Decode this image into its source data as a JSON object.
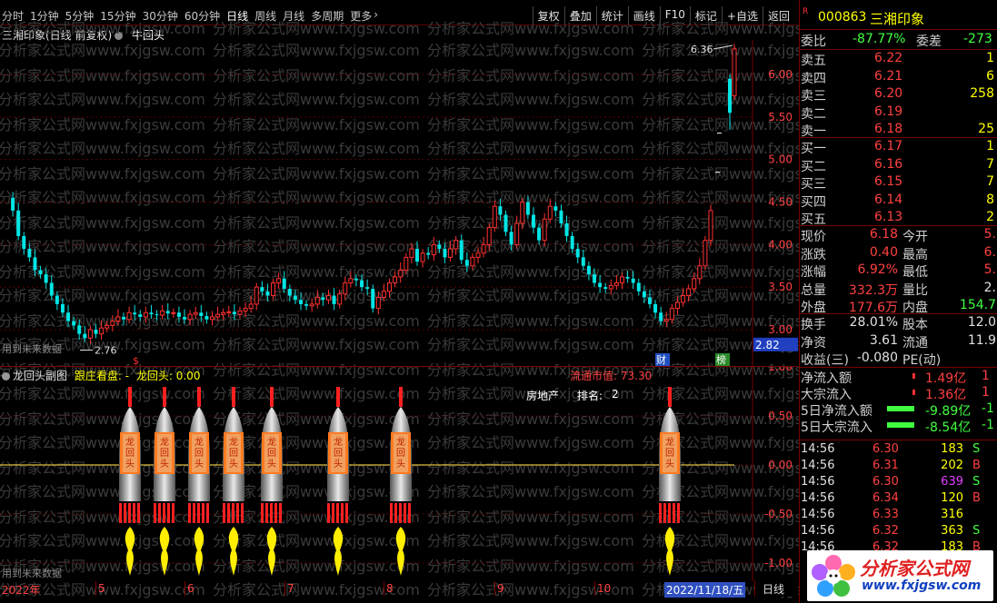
{
  "toolbar": {
    "timeframes": [
      "分时",
      "1分钟",
      "5分钟",
      "15分钟",
      "30分钟",
      "60分钟",
      "日线",
      "周线",
      "月线",
      "多周期",
      "更多"
    ],
    "active": "日线",
    "actions": [
      "复权",
      "叠加",
      "统计",
      "画线",
      "F10",
      "标记",
      "+自选",
      "返回"
    ]
  },
  "main_chart": {
    "title": "三湘印象(日线 前复权)",
    "indicator": "牛回头",
    "y_ticks": [
      "6.00",
      "5.50",
      "5.00",
      "4.50",
      "4.00",
      "3.50",
      "3.00"
    ],
    "high_label": "6.36",
    "low_label": "2.76",
    "current_price_tag": "2.82",
    "note": "用到未来数据",
    "markers": {
      "s": "$",
      "cai": "财",
      "bang": "榜"
    }
  },
  "sub_chart": {
    "title": "龙回头副图",
    "label_a": "跟庄看盘: -",
    "label_b": "龙回头: 0.00",
    "float_cap": "流通市值: 73.30",
    "sector": "房地产",
    "rank_label": "排名:",
    "rank_value": "2",
    "y_ticks": [
      "1.00",
      "0.50",
      "0.00",
      "-0.50",
      "-1.00"
    ],
    "rocket_text": "龙回头",
    "note": "用到未来数据"
  },
  "x_axis": {
    "labels": [
      "2022年",
      "5",
      "6",
      "7",
      "8",
      "9",
      "10"
    ],
    "current_date": "2022/11/18/五",
    "period": "日线"
  },
  "quote": {
    "r_mark": "R",
    "code": "000863",
    "name": "三湘印象",
    "wei_bi_label": "委比",
    "wei_bi": "-87.77%",
    "wei_cha_label": "委差",
    "wei_cha": "-273",
    "asks": [
      {
        "label": "卖五",
        "price": "6.22",
        "vol": "1"
      },
      {
        "label": "卖四",
        "price": "6.21",
        "vol": "6"
      },
      {
        "label": "卖三",
        "price": "6.20",
        "vol": "258"
      },
      {
        "label": "卖二",
        "price": "6.19",
        "vol": ""
      },
      {
        "label": "卖一",
        "price": "6.18",
        "vol": "25"
      }
    ],
    "bids": [
      {
        "label": "买一",
        "price": "6.17",
        "vol": "1"
      },
      {
        "label": "买二",
        "price": "6.16",
        "vol": "7"
      },
      {
        "label": "买三",
        "price": "6.15",
        "vol": "7"
      },
      {
        "label": "买四",
        "price": "6.14",
        "vol": "8"
      },
      {
        "label": "买五",
        "price": "6.13",
        "vol": "2"
      }
    ],
    "stats": [
      {
        "l1": "现价",
        "v1": "6.18",
        "l2": "今开",
        "v2": "5."
      },
      {
        "l1": "涨跌",
        "v1": "0.40",
        "l2": "最高",
        "v2": "6."
      },
      {
        "l1": "涨幅",
        "v1": "6.92%",
        "l2": "最低",
        "v2": "5."
      },
      {
        "l1": "总量",
        "v1": "332.3万",
        "l2": "量比",
        "v2": "2."
      },
      {
        "l1": "外盘",
        "v1": "177.6万",
        "l2": "内盘",
        "v2": "154.7"
      }
    ],
    "stats2": [
      {
        "l1": "换手",
        "v1": "28.01%",
        "l2": "股本",
        "v2": "12.0"
      },
      {
        "l1": "净资",
        "v1": "3.61",
        "l2": "流通",
        "v2": "11.9"
      },
      {
        "l1": "收益(三)",
        "v1": "-0.080",
        "l2": "PE(动)",
        "v2": ""
      }
    ],
    "flows": [
      {
        "label": "净流入额",
        "value": "1.49亿",
        "tail": "1"
      },
      {
        "label": "大宗流入",
        "value": "1.36亿",
        "tail": "1"
      },
      {
        "label": "5日净流入额",
        "value": "-9.89亿",
        "tail": "-1"
      },
      {
        "label": "5日大宗流入",
        "value": "-8.54亿",
        "tail": "-1"
      }
    ],
    "ticks": [
      {
        "time": "14:56",
        "price": "6.30",
        "vol": "183",
        "side": "S"
      },
      {
        "time": "14:56",
        "price": "6.31",
        "vol": "202",
        "side": "B"
      },
      {
        "time": "14:56",
        "price": "6.30",
        "vol": "639",
        "side": "S"
      },
      {
        "time": "14:56",
        "price": "6.34",
        "vol": "120",
        "side": "B"
      },
      {
        "time": "14:56",
        "price": "6.33",
        "vol": "316",
        "side": ""
      },
      {
        "time": "14:56",
        "price": "6.32",
        "vol": "363",
        "side": "S"
      },
      {
        "time": "14:56",
        "price": "6.32",
        "vol": "183",
        "side": "B"
      }
    ]
  },
  "watermark": "分析家公式网www.fxjgsw.com",
  "logo": {
    "title": "分析家公式网",
    "url": "www.fxjgsw.com"
  }
}
